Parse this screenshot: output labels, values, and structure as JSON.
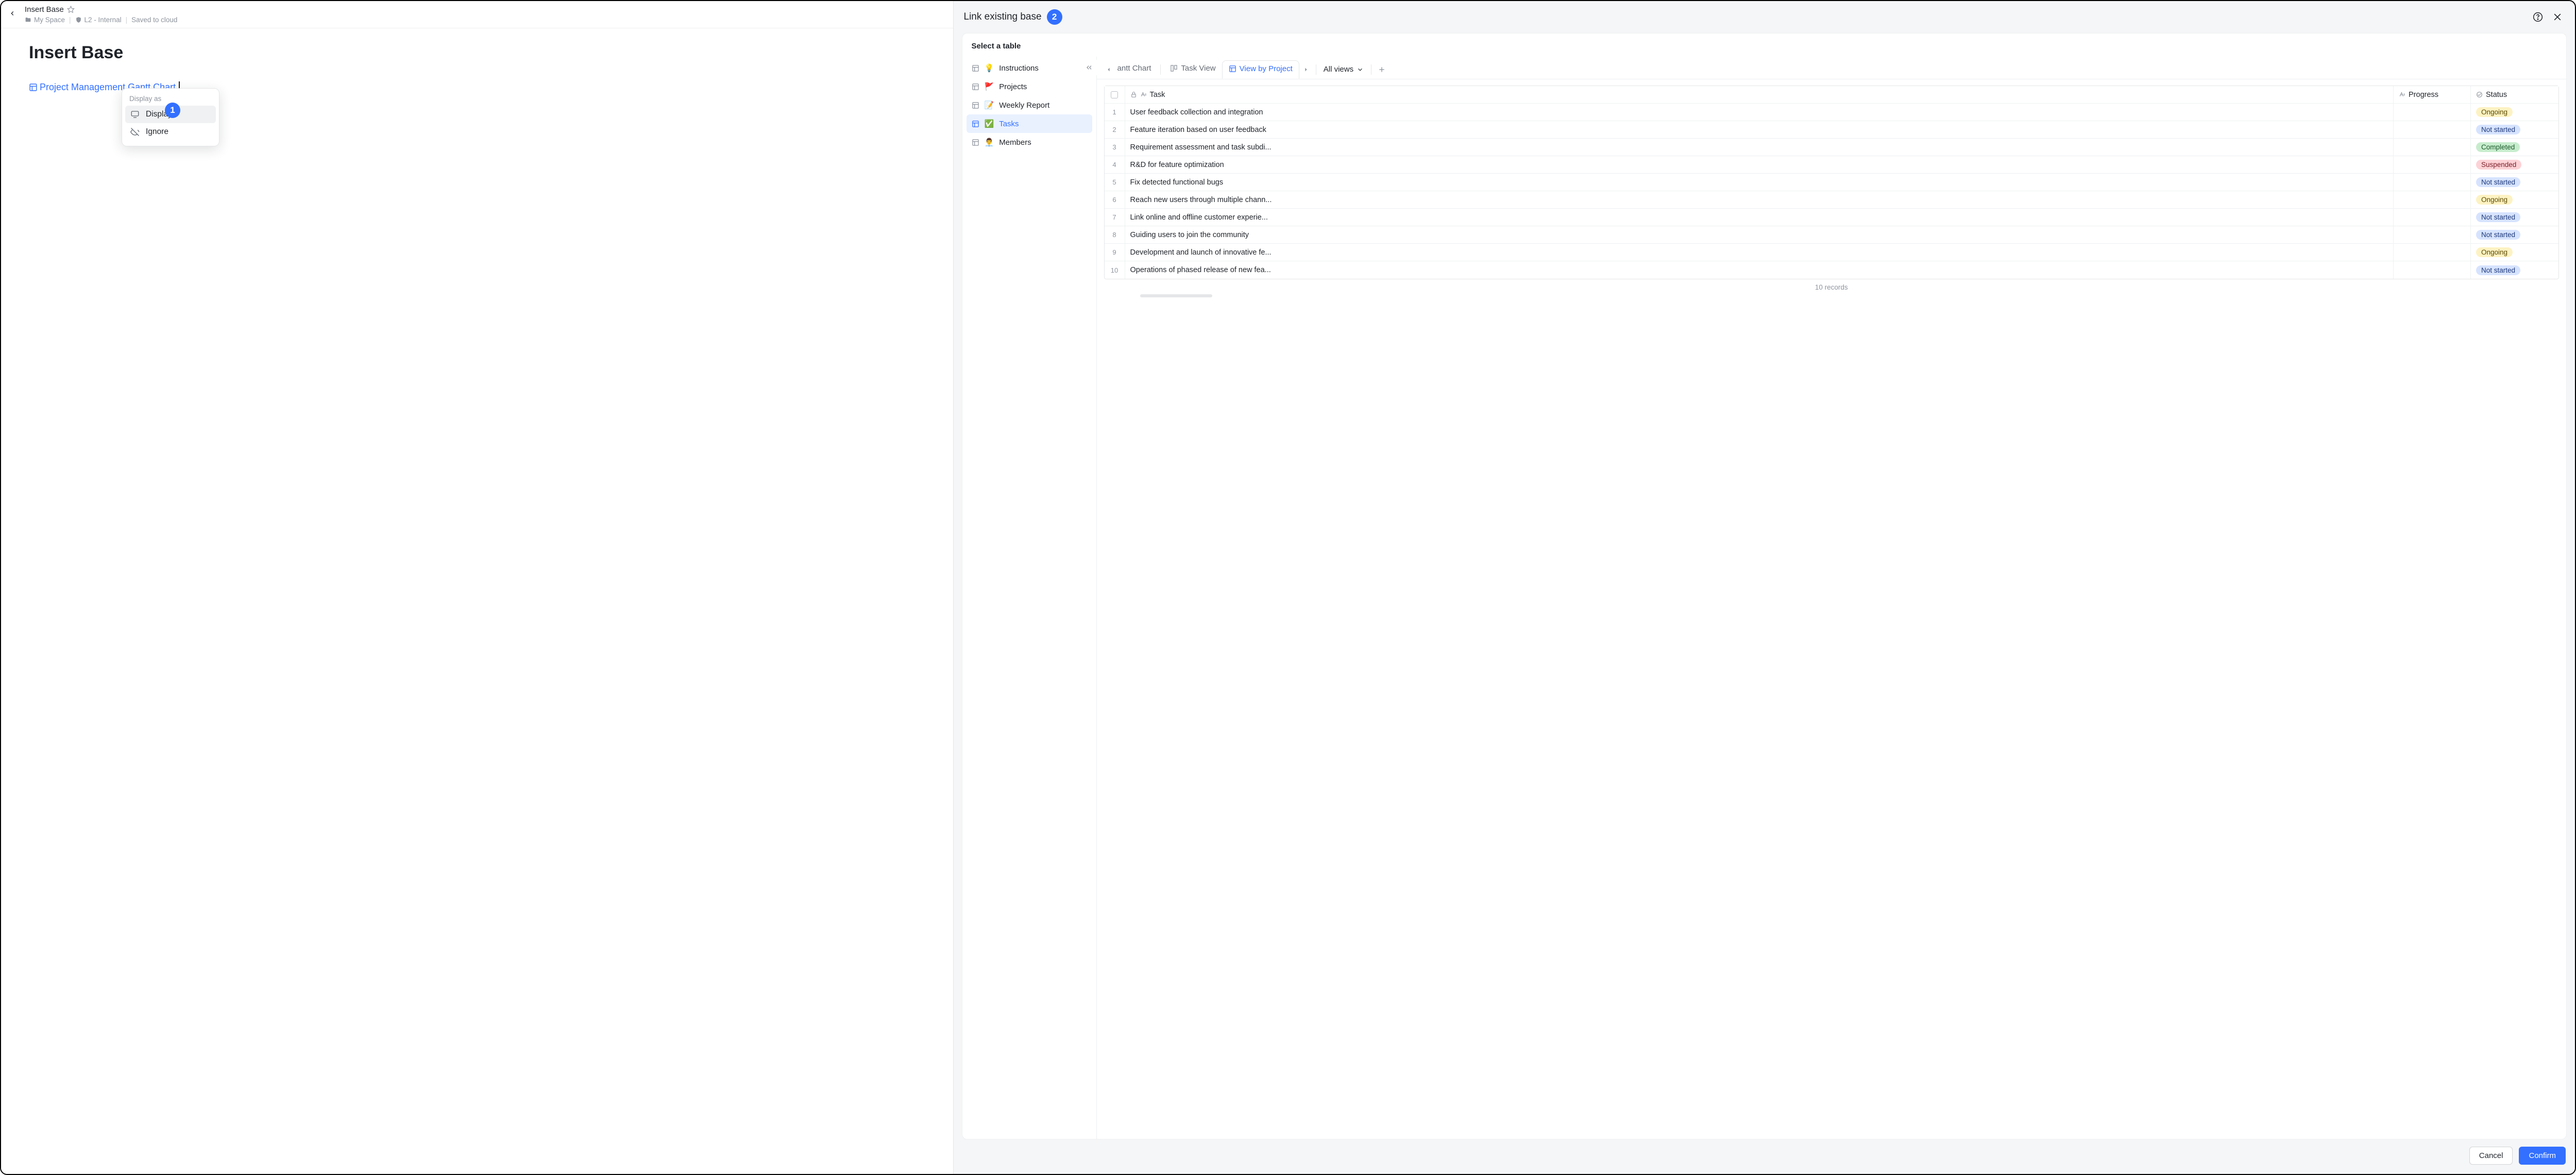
{
  "doc": {
    "title": "Insert Base",
    "breadcrumb": {
      "space": "My Space",
      "security": "L2 - Internal",
      "saved": "Saved to cloud"
    },
    "heading": "Insert Base",
    "inserted_link": "Project Management Gantt Chart"
  },
  "display_popover": {
    "title": "Display as",
    "items": [
      {
        "label": "Display",
        "icon": "monitor",
        "active": true
      },
      {
        "label": "Ignore",
        "icon": "eye-off",
        "active": false
      }
    ]
  },
  "step_badges": {
    "one": "1",
    "two": "2"
  },
  "panel": {
    "title": "Link existing base",
    "select_label": "Select a table",
    "tables": [
      {
        "emoji": "💡",
        "label": "Instructions",
        "selected": false
      },
      {
        "emoji": "🚩",
        "label": "Projects",
        "selected": false
      },
      {
        "emoji": "📝",
        "label": "Weekly Report",
        "selected": false
      },
      {
        "emoji": "✅",
        "label": "Tasks",
        "selected": true
      },
      {
        "emoji": "👨‍💼",
        "label": "Members",
        "selected": false
      }
    ],
    "tabs": {
      "truncated": "antt Chart",
      "task_view": "Task View",
      "view_by_project": "View by Project",
      "all_views": "All views"
    },
    "columns": {
      "task": "Task",
      "progress": "Progress",
      "status": "Status"
    },
    "rows": [
      {
        "n": "1",
        "task": "User feedback collection and integration",
        "status": "Ongoing",
        "badge": "b-ongoing"
      },
      {
        "n": "2",
        "task": "Feature iteration based on user feedback",
        "status": "Not started",
        "badge": "b-notstarted"
      },
      {
        "n": "3",
        "task": "Requirement assessment and task subdi...",
        "status": "Completed",
        "badge": "b-completed"
      },
      {
        "n": "4",
        "task": "R&D for feature optimization",
        "status": "Suspended",
        "badge": "b-suspended"
      },
      {
        "n": "5",
        "task": "Fix detected functional bugs",
        "status": "Not started",
        "badge": "b-notstarted"
      },
      {
        "n": "6",
        "task": "Reach new users through multiple chann...",
        "status": "Ongoing",
        "badge": "b-ongoing"
      },
      {
        "n": "7",
        "task": "Link online and offline customer experie...",
        "status": "Not started",
        "badge": "b-notstarted"
      },
      {
        "n": "8",
        "task": "Guiding users to join the community",
        "status": "Not started",
        "badge": "b-notstarted"
      },
      {
        "n": "9",
        "task": "Development and launch of innovative fe...",
        "status": "Ongoing",
        "badge": "b-ongoing"
      },
      {
        "n": "10",
        "task": "Operations of phased release of new fea...",
        "status": "Not started",
        "badge": "b-notstarted"
      }
    ],
    "record_count": "10 records",
    "footer": {
      "cancel": "Cancel",
      "confirm": "Confirm"
    }
  }
}
